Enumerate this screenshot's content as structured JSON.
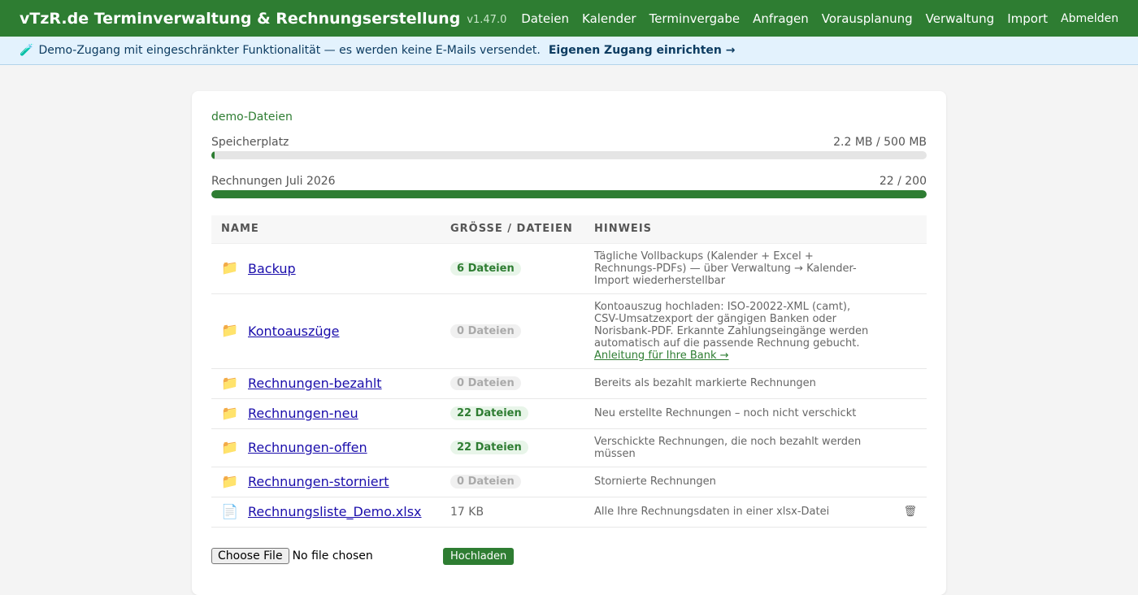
{
  "app": {
    "title": "vTzR.de Terminverwaltung & Rechnungserstellung",
    "version": "v1.47.0"
  },
  "nav": {
    "items": [
      "Dateien",
      "Kalender",
      "Terminvergabe",
      "Anfragen",
      "Vorausplanung",
      "Verwaltung",
      "Import"
    ],
    "logout": "Abmelden"
  },
  "banner": {
    "icon": "🧪",
    "text": "Demo-Zugang mit eingeschränkter Funktionalität — es werden keine E-Mails versendet.",
    "link": "Eigenen Zugang einrichten →"
  },
  "card": {
    "title": "demo-Dateien",
    "storage": {
      "label": "Speicherplatz",
      "value": "2.2 MB / 500 MB",
      "fraction": 0.0044
    },
    "invoices": {
      "label": "Rechnungen Juli 2026",
      "value": "22 / 200",
      "fraction": 1.0
    }
  },
  "table": {
    "headers": {
      "name": "NAME",
      "size": "GRÖSSE / DATEIEN",
      "hint": "HINWEIS"
    },
    "rows": [
      {
        "icon": "folder-icon",
        "name": "Backup",
        "size": "6 Dateien",
        "empty": false,
        "hint": "Tägliche Vollbackups (Kalender + Excel + Rechnungs-PDFs) — über Verwaltung → Kalender-Import wiederherstellbar"
      },
      {
        "icon": "folder-icon",
        "name": "Kontoauszüge",
        "size": "0 Dateien",
        "empty": true,
        "hint": "Kontoauszug hochladen: ISO-20022-XML (camt), CSV-Umsatzexport der gängigen Banken oder Norisbank-PDF. Erkannte Zahlungseingänge werden automatisch auf die passende Rechnung gebucht.",
        "hint_link": "Anleitung für Ihre Bank →"
      },
      {
        "icon": "folder-icon",
        "name": "Rechnungen-bezahlt",
        "size": "0 Dateien",
        "empty": true,
        "hint": "Bereits als bezahlt markierte Rechnungen"
      },
      {
        "icon": "folder-icon",
        "name": "Rechnungen-neu",
        "size": "22 Dateien",
        "empty": false,
        "hint": "Neu erstellte Rechnungen – noch nicht verschickt"
      },
      {
        "icon": "folder-icon",
        "name": "Rechnungen-offen",
        "size": "22 Dateien",
        "empty": false,
        "hint": "Verschickte Rechnungen, die noch bezahlt werden müssen"
      },
      {
        "icon": "folder-icon",
        "name": "Rechnungen-storniert",
        "size": "0 Dateien",
        "empty": true,
        "hint": "Stornierte Rechnungen"
      },
      {
        "icon": "file-icon",
        "name": "Rechnungsliste_Demo.xlsx",
        "size": "17 KB",
        "empty": null,
        "hint": "Alle Ihre Rechnungsdaten in einer xlsx-Datei",
        "deletable": true
      }
    ]
  },
  "upload": {
    "choose_label": "Choose File",
    "no_file": "No file chosen",
    "submit_label": "Hochladen"
  }
}
